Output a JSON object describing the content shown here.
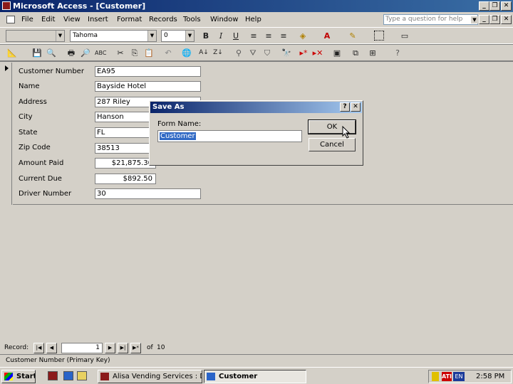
{
  "app": {
    "title": "Microsoft Access - [Customer]"
  },
  "window_buttons": {
    "minimize": "_",
    "restore": "❐",
    "close": "✕"
  },
  "menu": {
    "items": [
      "File",
      "Edit",
      "View",
      "Insert",
      "Format",
      "Records",
      "Tools",
      "Window",
      "Help"
    ],
    "help_placeholder": "Type a question for help",
    "doc_buttons": {
      "minimize": "_",
      "restore": "❐",
      "close": "✕"
    }
  },
  "format_toolbar": {
    "object_value": "",
    "font_value": "Tahoma",
    "size_value": "0",
    "bold": "B",
    "italic": "I",
    "underline": "U"
  },
  "form": {
    "fields": [
      {
        "label": "Customer Number",
        "value": "EA95"
      },
      {
        "label": "Name",
        "value": "Bayside Hotel"
      },
      {
        "label": "Address",
        "value": "287 Riley"
      },
      {
        "label": "City",
        "value": "Hanson"
      },
      {
        "label": "State",
        "value": "FL"
      },
      {
        "label": "Zip Code",
        "value": "38513"
      },
      {
        "label": "Amount Paid",
        "value": "$21,875.30"
      },
      {
        "label": "Current Due",
        "value": "$892.50"
      },
      {
        "label": "Driver Number",
        "value": "30"
      }
    ]
  },
  "dialog": {
    "title": "Save As",
    "help_btn": "?",
    "close_btn": "✕",
    "field_label": "Form Name:",
    "field_value": "Customer",
    "ok_label": "OK",
    "cancel_label": "Cancel"
  },
  "navigation": {
    "record_label": "Record:",
    "current": "1",
    "of_label": "of",
    "total": "10"
  },
  "status": {
    "text": "Customer Number (Primary Key)"
  },
  "taskbar": {
    "start_label": "Start",
    "tasks": [
      "Alisa Vending Services : D...",
      "Customer"
    ],
    "tray_lang": "EN",
    "clock": "2:58 PM"
  }
}
